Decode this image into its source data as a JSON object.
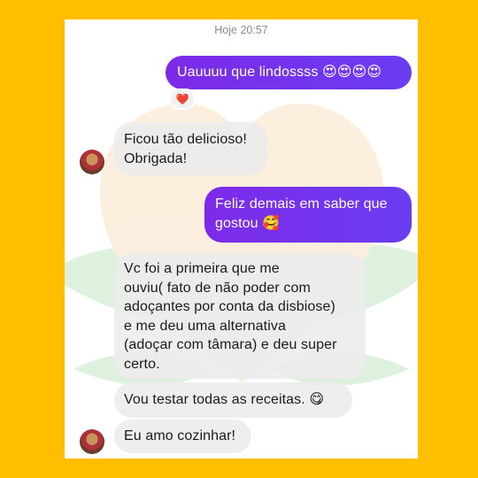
{
  "chat": {
    "timestamp": "Hoje 20:57",
    "messages": [
      {
        "id": "m1",
        "dir": "out",
        "text": "Uauuuu que lindossss 😍😍😍😍"
      },
      {
        "id": "m2",
        "dir": "in",
        "text": "Ficou tão delicioso!\nObrigada!"
      },
      {
        "id": "m3",
        "dir": "out",
        "text": "Feliz demais em saber que\ngostou 🥰"
      },
      {
        "id": "m4",
        "dir": "in",
        "text": "Vc foi a primeira que me\nouviu( fato de não poder com\nadoçantes por conta da disbiose)\ne me deu uma alternativa\n(adoçar com tâmara) e deu super\ncerto."
      },
      {
        "id": "m5",
        "dir": "in",
        "text": "Vou testar todas as receitas. 😋"
      },
      {
        "id": "m6",
        "dir": "in",
        "text": "Eu amo cozinhar!"
      }
    ],
    "reaction": "❤️"
  },
  "colors": {
    "background": "#FFBE00",
    "outgoing": "#7d2ae8",
    "incoming": "#ececec"
  },
  "icons": {
    "reaction": "heart-icon",
    "avatar": "contact-avatar"
  }
}
